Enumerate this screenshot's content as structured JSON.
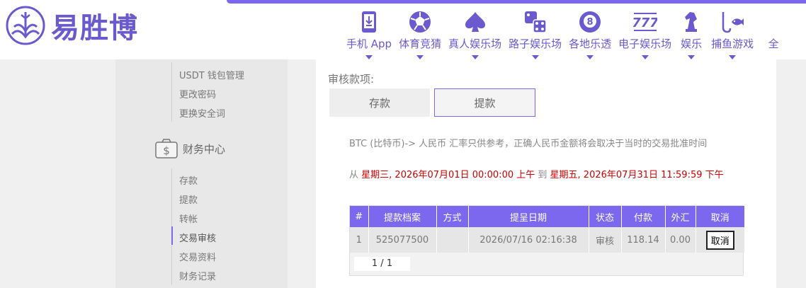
{
  "brand": {
    "name": "易胜博",
    "accent": "#7b68ee"
  },
  "nav": [
    {
      "label": "手机 App",
      "icon": "mobile-download-icon"
    },
    {
      "label": "体育竞猜",
      "icon": "soccer-ball-icon"
    },
    {
      "label": "真人娱乐场",
      "icon": "spade-icon"
    },
    {
      "label": "路子娱乐场",
      "icon": "dice-icon"
    },
    {
      "label": "各地乐透",
      "icon": "lottery-ball-8-icon"
    },
    {
      "label": "电子娱乐场",
      "icon": "slot-777-icon"
    },
    {
      "label": "娱乐",
      "icon": "chess-knight-icon"
    },
    {
      "label": "捕鱼游戏",
      "icon": "fishing-icon"
    },
    {
      "label": "全"
    }
  ],
  "sidebar": {
    "account_links": [
      "USDT 钱包管理",
      "更改密码",
      "更换安全词"
    ],
    "finance_title": "财务中心",
    "finance_links": [
      "存款",
      "提款",
      "转帐",
      "交易审核",
      "交易资料",
      "财务记录"
    ],
    "active": "交易审核"
  },
  "main": {
    "audit_label": "审核款项:",
    "tabs": {
      "deposit": "存款",
      "withdraw": "提款"
    },
    "info_text": "BTC (比特币)-> 人民币 汇率只供参考，正确人民币金额将会取决于当时的交易批准时间",
    "range": {
      "from_word": "从",
      "from": "星期三, 2026年07月01日 00:00:00 上午",
      "to_word": "到",
      "to": "星期五, 2026年07月31日 11:59:59 下午"
    },
    "table": {
      "headers": [
        "#",
        "提款档案",
        "方式",
        "提呈日期",
        "状态",
        "付款",
        "外汇",
        "取消"
      ],
      "rows": [
        {
          "index": "1",
          "file": "525077500",
          "method": "",
          "date": "2026/07/16 02:16:38",
          "status": "审核",
          "payment": "118.14",
          "fx": "0.00",
          "cancel": "取消"
        }
      ],
      "pager": "1  / 1"
    }
  }
}
